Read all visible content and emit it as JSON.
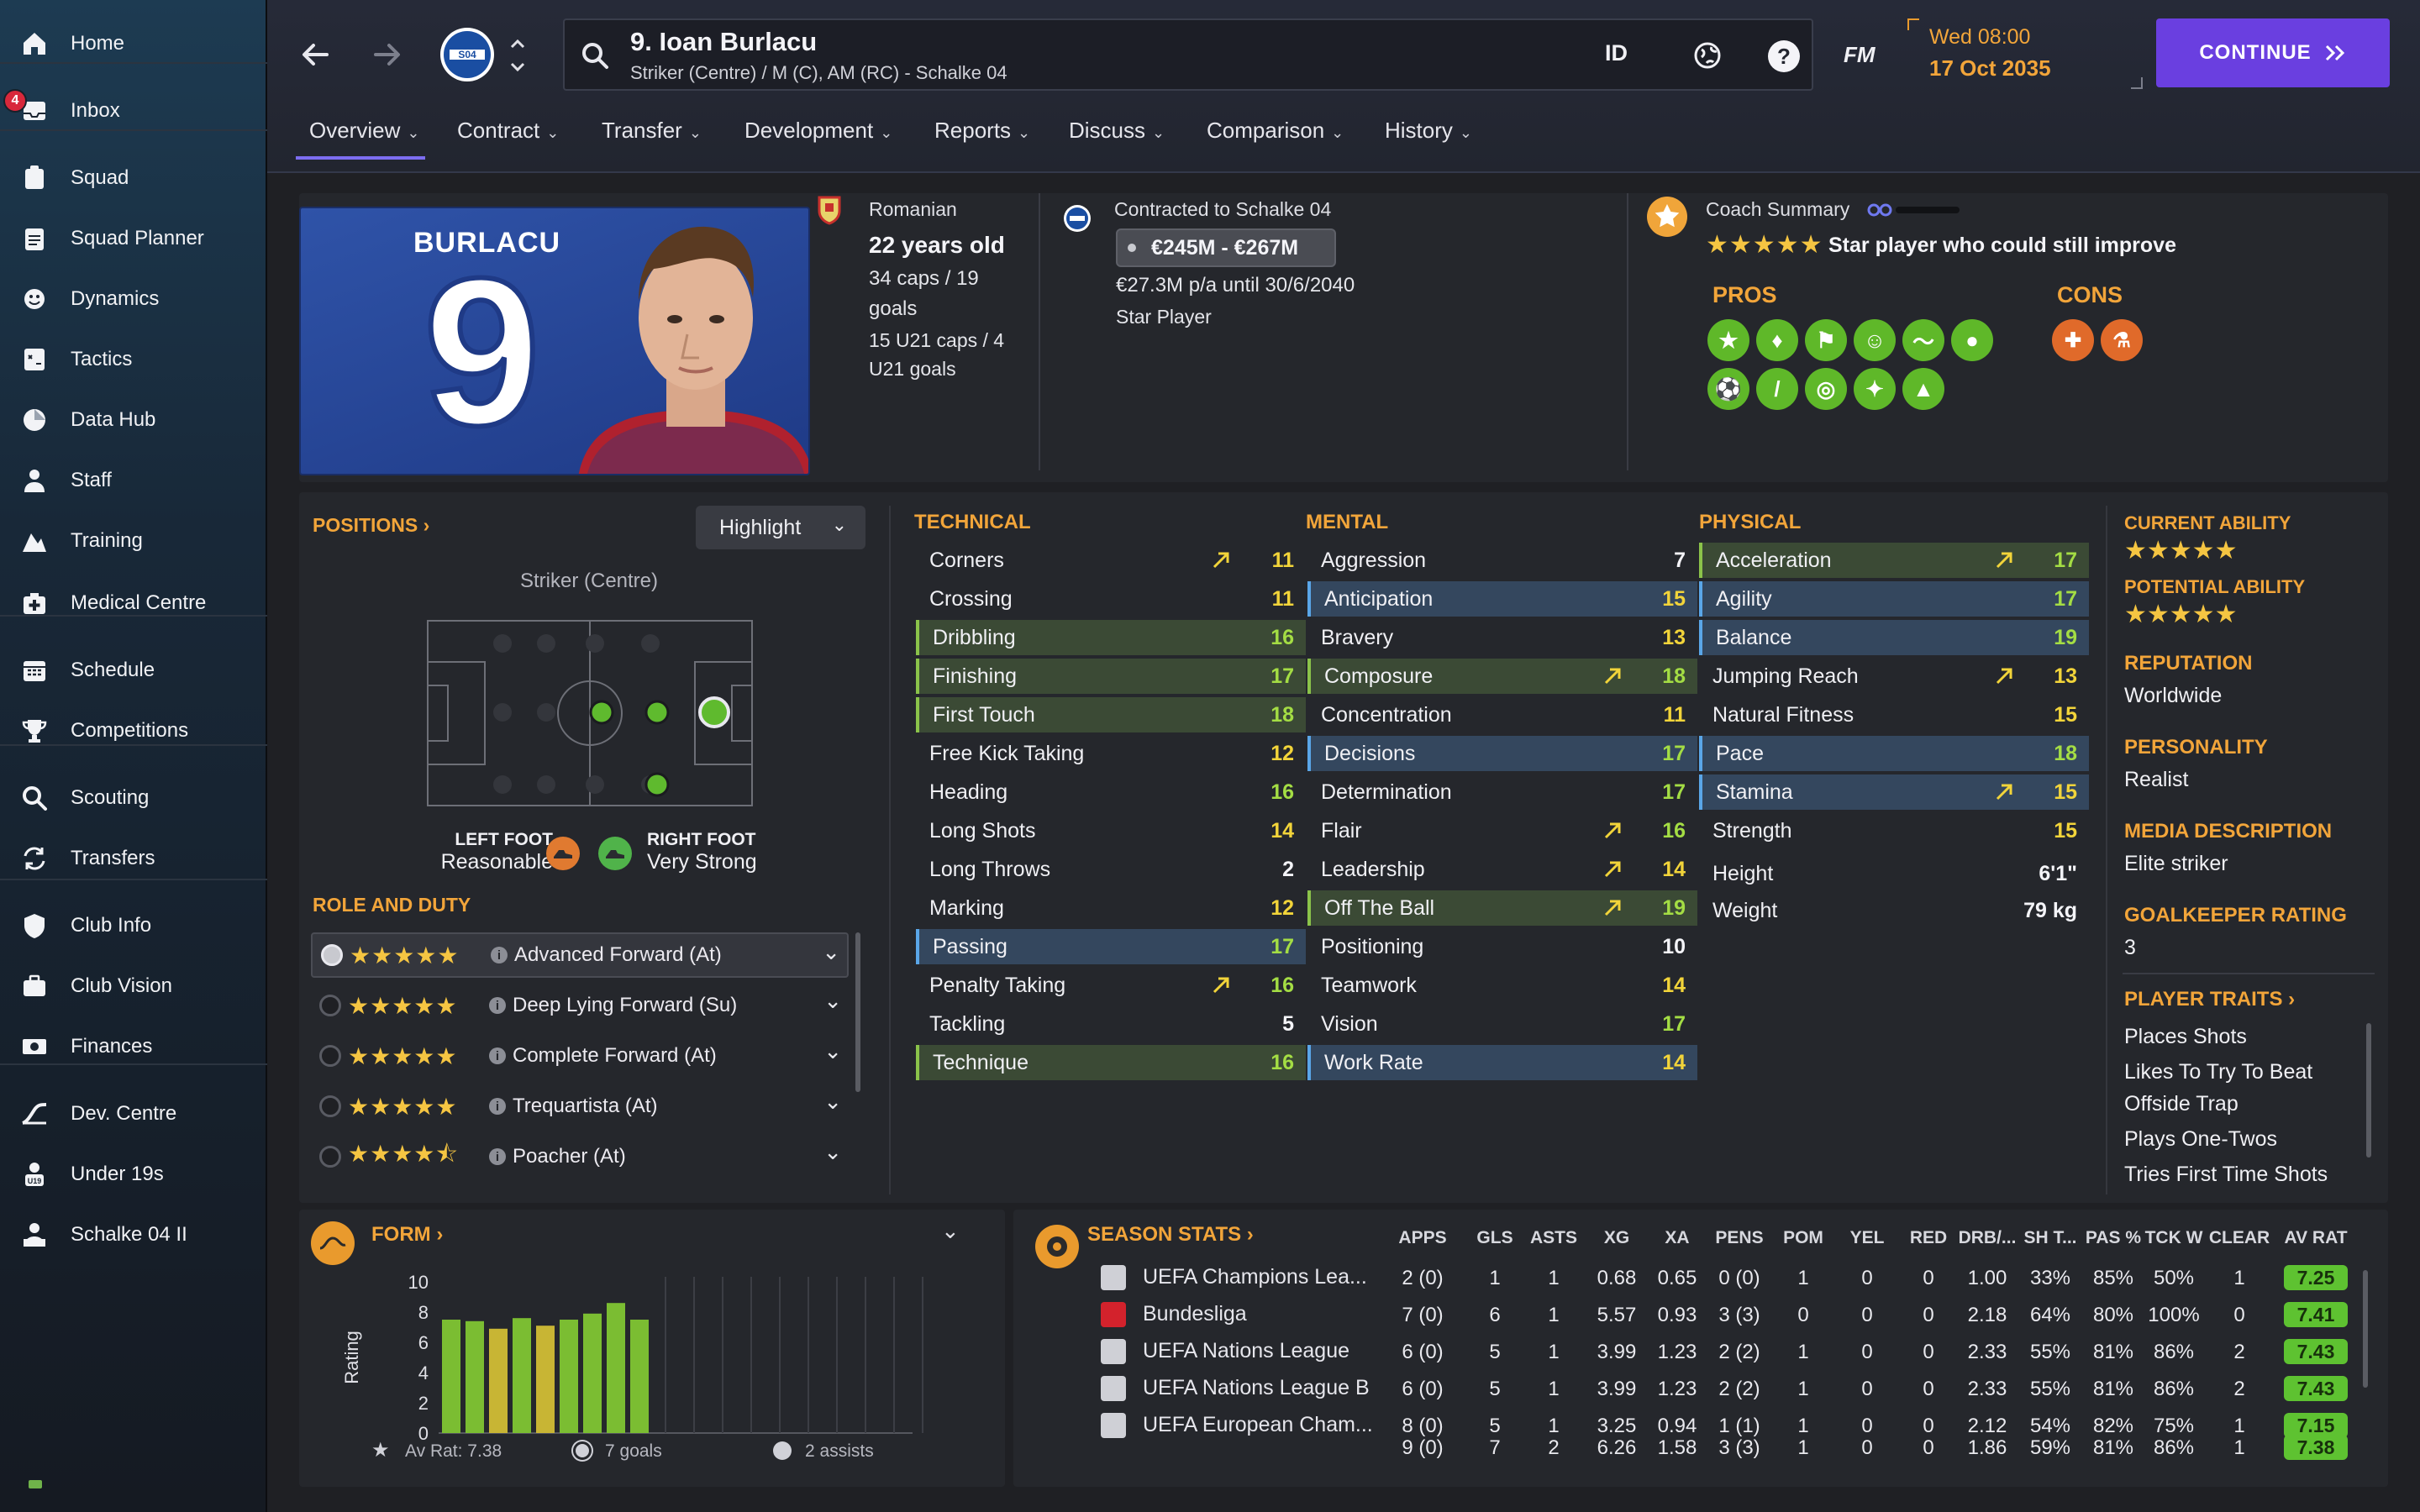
{
  "sidebar": {
    "items": [
      {
        "label": "Home",
        "icon": "home-icon"
      },
      {
        "label": "Inbox",
        "icon": "inbox-icon",
        "badge": "4"
      },
      {
        "label": "Squad",
        "icon": "squad-icon"
      },
      {
        "label": "Squad Planner",
        "icon": "clipboard-icon"
      },
      {
        "label": "Dynamics",
        "icon": "dynamics-icon"
      },
      {
        "label": "Tactics",
        "icon": "tactics-icon"
      },
      {
        "label": "Data Hub",
        "icon": "data-hub-icon"
      },
      {
        "label": "Staff",
        "icon": "staff-icon"
      },
      {
        "label": "Training",
        "icon": "training-icon"
      },
      {
        "label": "Medical Centre",
        "icon": "medical-icon"
      },
      {
        "label": "Schedule",
        "icon": "calendar-icon"
      },
      {
        "label": "Competitions",
        "icon": "trophy-icon"
      },
      {
        "label": "Scouting",
        "icon": "search-icon"
      },
      {
        "label": "Transfers",
        "icon": "transfer-icon"
      },
      {
        "label": "Club Info",
        "icon": "shield-icon"
      },
      {
        "label": "Club Vision",
        "icon": "briefcase-icon"
      },
      {
        "label": "Finances",
        "icon": "money-icon"
      },
      {
        "label": "Dev. Centre",
        "icon": "dev-centre-icon"
      },
      {
        "label": "Under 19s",
        "icon": "under19-icon",
        "badge_text": "U19"
      },
      {
        "label": "Schalke 04 II",
        "icon": "reserve-team-icon"
      }
    ]
  },
  "topbar": {
    "player_title": "9. Ioan Burlacu",
    "player_subtitle": "Striker (Centre) / M (C), AM (RC) - Schalke 04",
    "club_badge": "S04",
    "id_label": "ID",
    "fm_label": "FM",
    "date_day": "Wed 08:00",
    "date_full": "17 Oct 2035",
    "continue_label": "CONTINUE"
  },
  "tabs": [
    "Overview",
    "Contract",
    "Transfer",
    "Development",
    "Reports",
    "Discuss",
    "Comparison",
    "History"
  ],
  "profile": {
    "shirt_name": "BURLACU",
    "shirt_number": "9",
    "nationality": "Romanian",
    "age": "22 years old",
    "caps": "34 caps / 19",
    "caps_goals": "goals",
    "u21_caps": "15 U21 caps / 4",
    "u21_goals": "U21 goals",
    "contract_title": "Contracted to Schalke 04",
    "value_range": "€245M - €267M",
    "wage": "€27.3M p/a until 30/6/2040",
    "status": "Star Player"
  },
  "coach": {
    "title": "Coach Summary",
    "summary": "Star player who could still improve",
    "stars": 5,
    "pros_label": "PROS",
    "cons_label": "CONS",
    "pros_icons": [
      "star-icon",
      "fitness-icon",
      "flag-icon",
      "mentality-icon",
      "pace-icon",
      "brain-icon",
      "ball-icon",
      "shooting-icon",
      "target-icon",
      "handshake-icon",
      "growth-icon"
    ],
    "cons_icons": [
      "set-piece-icon",
      "flask-icon"
    ]
  },
  "positions": {
    "title": "POSITIONS",
    "highlight_label": "Highlight",
    "position_name": "Striker (Centre)",
    "left_foot_label": "LEFT FOOT",
    "left_foot_value": "Reasonable",
    "right_foot_label": "RIGHT FOOT",
    "right_foot_value": "Very Strong"
  },
  "roles": {
    "title": "ROLE AND DUTY",
    "items": [
      {
        "name": "Advanced Forward (At)",
        "stars": 5
      },
      {
        "name": "Deep Lying Forward (Su)",
        "stars": 5
      },
      {
        "name": "Complete Forward (At)",
        "stars": 5
      },
      {
        "name": "Trequartista (At)",
        "stars": 5
      },
      {
        "name": "Poacher (At)",
        "stars": 4.5
      }
    ]
  },
  "attributes": {
    "technical_title": "TECHNICAL",
    "mental_title": "MENTAL",
    "physical_title": "PHYSICAL",
    "technical": [
      {
        "name": "Corners",
        "value": "11",
        "arrow": true,
        "hl": ""
      },
      {
        "name": "Crossing",
        "value": "11",
        "arrow": false,
        "hl": ""
      },
      {
        "name": "Dribbling",
        "value": "16",
        "arrow": false,
        "hl": "green"
      },
      {
        "name": "Finishing",
        "value": "17",
        "arrow": false,
        "hl": "green"
      },
      {
        "name": "First Touch",
        "value": "18",
        "arrow": false,
        "hl": "green"
      },
      {
        "name": "Free Kick Taking",
        "value": "12",
        "arrow": false,
        "hl": ""
      },
      {
        "name": "Heading",
        "value": "16",
        "arrow": false,
        "hl": ""
      },
      {
        "name": "Long Shots",
        "value": "14",
        "arrow": false,
        "hl": ""
      },
      {
        "name": "Long Throws",
        "value": "2",
        "arrow": false,
        "hl": ""
      },
      {
        "name": "Marking",
        "value": "12",
        "arrow": false,
        "hl": ""
      },
      {
        "name": "Passing",
        "value": "17",
        "arrow": false,
        "hl": "blue"
      },
      {
        "name": "Penalty Taking",
        "value": "16",
        "arrow": true,
        "hl": ""
      },
      {
        "name": "Tackling",
        "value": "5",
        "arrow": false,
        "hl": ""
      },
      {
        "name": "Technique",
        "value": "16",
        "arrow": false,
        "hl": "green"
      }
    ],
    "mental": [
      {
        "name": "Aggression",
        "value": "7",
        "arrow": false,
        "hl": ""
      },
      {
        "name": "Anticipation",
        "value": "15",
        "arrow": false,
        "hl": "blue"
      },
      {
        "name": "Bravery",
        "value": "13",
        "arrow": false,
        "hl": ""
      },
      {
        "name": "Composure",
        "value": "18",
        "arrow": true,
        "hl": "green"
      },
      {
        "name": "Concentration",
        "value": "11",
        "arrow": false,
        "hl": ""
      },
      {
        "name": "Decisions",
        "value": "17",
        "arrow": false,
        "hl": "blue"
      },
      {
        "name": "Determination",
        "value": "17",
        "arrow": false,
        "hl": ""
      },
      {
        "name": "Flair",
        "value": "16",
        "arrow": true,
        "hl": ""
      },
      {
        "name": "Leadership",
        "value": "14",
        "arrow": true,
        "hl": ""
      },
      {
        "name": "Off The Ball",
        "value": "19",
        "arrow": true,
        "hl": "green"
      },
      {
        "name": "Positioning",
        "value": "10",
        "arrow": false,
        "hl": ""
      },
      {
        "name": "Teamwork",
        "value": "14",
        "arrow": false,
        "hl": ""
      },
      {
        "name": "Vision",
        "value": "17",
        "arrow": false,
        "hl": ""
      },
      {
        "name": "Work Rate",
        "value": "14",
        "arrow": false,
        "hl": "blue"
      }
    ],
    "physical": [
      {
        "name": "Acceleration",
        "value": "17",
        "arrow": true,
        "hl": "green"
      },
      {
        "name": "Agility",
        "value": "17",
        "arrow": false,
        "hl": "blue"
      },
      {
        "name": "Balance",
        "value": "19",
        "arrow": false,
        "hl": "blue"
      },
      {
        "name": "Jumping Reach",
        "value": "13",
        "arrow": true,
        "hl": ""
      },
      {
        "name": "Natural Fitness",
        "value": "15",
        "arrow": false,
        "hl": ""
      },
      {
        "name": "Pace",
        "value": "18",
        "arrow": false,
        "hl": "blue"
      },
      {
        "name": "Stamina",
        "value": "15",
        "arrow": true,
        "hl": "blue"
      },
      {
        "name": "Strength",
        "value": "15",
        "arrow": false,
        "hl": ""
      }
    ],
    "height_label": "Height",
    "height_value": "6'1\"",
    "weight_label": "Weight",
    "weight_value": "79 kg"
  },
  "side_info": {
    "current_ability_label": "CURRENT ABILITY",
    "potential_ability_label": "POTENTIAL ABILITY",
    "reputation_label": "REPUTATION",
    "reputation_value": "Worldwide",
    "personality_label": "PERSONALITY",
    "personality_value": "Realist",
    "media_label": "MEDIA DESCRIPTION",
    "media_value": "Elite striker",
    "gk_label": "GOALKEEPER RATING",
    "gk_value": "3",
    "traits_label": "PLAYER TRAITS",
    "traits": [
      "Places Shots",
      "Likes To Try To Beat",
      "Offside Trap",
      "Plays One-Twos",
      "Tries First Time Shots"
    ]
  },
  "form": {
    "title": "FORM",
    "ylabel": "Rating",
    "av_rat": "Av Rat: 7.38",
    "goals": "7 goals",
    "assists": "2 assists"
  },
  "chart_data": {
    "type": "bar",
    "title": "FORM",
    "ylabel": "Rating",
    "ylim": [
      0,
      10
    ],
    "yticks": [
      "10",
      "8",
      "6",
      "4",
      "2",
      "0"
    ],
    "values": [
      7.5,
      7.4,
      6.9,
      7.6,
      7.1,
      7.5,
      7.9,
      8.6,
      7.5
    ],
    "colors": [
      "#7bbd32",
      "#7bbd32",
      "#c8b534",
      "#7bbd32",
      "#c8b534",
      "#7bbd32",
      "#7bbd32",
      "#7bbd32",
      "#7bbd32"
    ],
    "empty_slots": 10
  },
  "season_stats": {
    "title": "SEASON STATS",
    "columns": [
      "APPS",
      "GLS",
      "ASTS",
      "XG",
      "XA",
      "PENS",
      "POM",
      "YEL",
      "RED",
      "DRB/...",
      "SH T...",
      "PAS %",
      "TCK W",
      "CLEAR",
      "AV RAT"
    ],
    "rows": [
      {
        "comp": "UEFA Champions Lea...",
        "icon": "ucl-icon",
        "cells": [
          "2 (0)",
          "1",
          "1",
          "0.68",
          "0.65",
          "0 (0)",
          "1",
          "0",
          "0",
          "1.00",
          "33%",
          "85%",
          "50%",
          "1"
        ],
        "rating": "7.25"
      },
      {
        "comp": "Bundesliga",
        "icon": "bundesliga-icon",
        "cells": [
          "7 (0)",
          "6",
          "1",
          "5.57",
          "0.93",
          "3 (3)",
          "0",
          "0",
          "0",
          "2.18",
          "64%",
          "80%",
          "100%",
          "0"
        ],
        "rating": "7.41"
      },
      {
        "comp": "UEFA Nations League",
        "icon": "nations-league-icon",
        "cells": [
          "6 (0)",
          "5",
          "1",
          "3.99",
          "1.23",
          "2 (2)",
          "1",
          "0",
          "0",
          "2.33",
          "55%",
          "81%",
          "86%",
          "2"
        ],
        "rating": "7.43"
      },
      {
        "comp": "UEFA Nations League B",
        "icon": "nations-league-b-icon",
        "cells": [
          "6 (0)",
          "5",
          "1",
          "3.99",
          "1.23",
          "2 (2)",
          "1",
          "0",
          "0",
          "2.33",
          "55%",
          "81%",
          "86%",
          "2"
        ],
        "rating": "7.43"
      },
      {
        "comp": "UEFA European Cham...",
        "icon": "euro-icon",
        "cells": [
          "8 (0)",
          "5",
          "1",
          "3.25",
          "0.94",
          "1 (1)",
          "1",
          "0",
          "0",
          "2.12",
          "54%",
          "82%",
          "75%",
          "1"
        ],
        "rating": "7.15"
      }
    ],
    "total": {
      "cells": [
        "9 (0)",
        "7",
        "2",
        "6.26",
        "1.58",
        "3 (3)",
        "1",
        "0",
        "0",
        "1.86",
        "59%",
        "81%",
        "86%",
        "1"
      ],
      "rating": "7.38"
    }
  }
}
